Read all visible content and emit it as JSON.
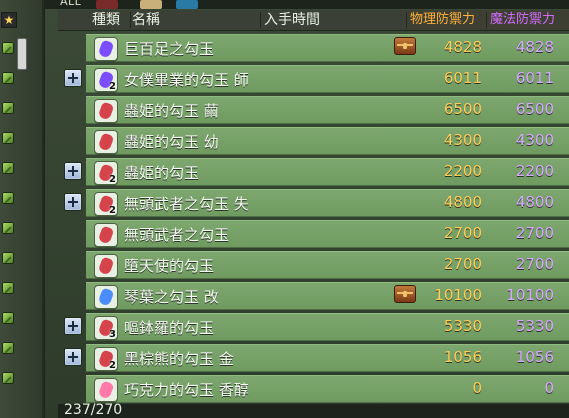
{
  "tab_label": "ALL",
  "header": {
    "type": "種類",
    "name": "名稱",
    "acquired": "入手時間",
    "phys": "物理防禦力",
    "mag": "魔法防禦力"
  },
  "rows": [
    {
      "name": "巨百足之勾玉",
      "has_plus": false,
      "stack": "",
      "phys": "4828",
      "mag": "4828",
      "chest": true,
      "gem_color": "#7c4cff"
    },
    {
      "name": "女僕畢業的勾玉 師",
      "has_plus": true,
      "stack": "2",
      "phys": "6011",
      "mag": "6011",
      "chest": false,
      "gem_color": "#7c4cff"
    },
    {
      "name": "蟲姫的勾玉 繭",
      "has_plus": false,
      "stack": "",
      "phys": "6500",
      "mag": "6500",
      "chest": false,
      "gem_color": "#d6444b"
    },
    {
      "name": "蟲姫的勾玉 幼",
      "has_plus": false,
      "stack": "",
      "phys": "4300",
      "mag": "4300",
      "chest": false,
      "gem_color": "#d6444b"
    },
    {
      "name": "蟲姫的勾玉",
      "has_plus": true,
      "stack": "2",
      "phys": "2200",
      "mag": "2200",
      "chest": false,
      "gem_color": "#d6444b"
    },
    {
      "name": "無頭武者之勾玉 失",
      "has_plus": true,
      "stack": "2",
      "phys": "4800",
      "mag": "4800",
      "chest": false,
      "gem_color": "#d6444b"
    },
    {
      "name": "無頭武者之勾玉",
      "has_plus": false,
      "stack": "",
      "phys": "2700",
      "mag": "2700",
      "chest": false,
      "gem_color": "#d6444b"
    },
    {
      "name": "墮天使的勾玉",
      "has_plus": false,
      "stack": "",
      "phys": "2700",
      "mag": "2700",
      "chest": false,
      "gem_color": "#d6444b"
    },
    {
      "name": "琴葉之勾玉 改",
      "has_plus": false,
      "stack": "",
      "phys": "10100",
      "mag": "10100",
      "chest": true,
      "gem_color": "#4b8dff"
    },
    {
      "name": "嘔鉢羅的勾玉",
      "has_plus": true,
      "stack": "3",
      "phys": "5330",
      "mag": "5330",
      "chest": false,
      "gem_color": "#d6444b"
    },
    {
      "name": "黑棕熊的勾玉 金",
      "has_plus": true,
      "stack": "2",
      "phys": "1056",
      "mag": "1056",
      "chest": false,
      "gem_color": "#d6444b"
    },
    {
      "name": "巧克力的勾玉 香醇",
      "has_plus": false,
      "stack": "",
      "phys": "0",
      "mag": "0",
      "chest": false,
      "gem_color": "#ff7aa8"
    }
  ],
  "footer": {
    "count": "237/270"
  },
  "colors": {
    "row_green": "#7da76e",
    "header_dark": "#3a4035",
    "orange": "#ffcc57",
    "purple": "#d7a6ff"
  }
}
